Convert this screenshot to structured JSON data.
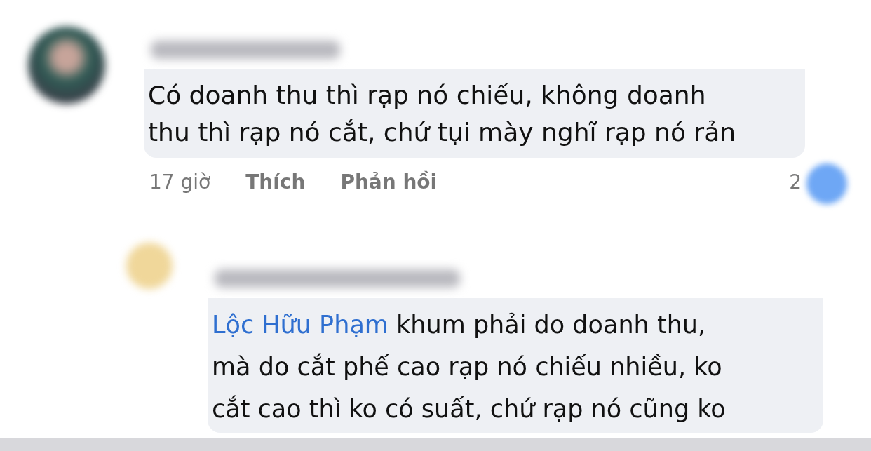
{
  "comments": [
    {
      "text": "Có doanh thu thì rạp nó chiếu, không doanh\nthu thì rạp nó cắt, chứ tụi mày nghĩ rạp nó rản",
      "time": "17 giờ",
      "actions": [
        "Thích",
        "Phản hồi"
      ],
      "reaction_count": "2",
      "replies": [
        {
          "mention": "Lộc Hữu Phạm",
          "text": "khum phải do doanh thu,\nmà do cắt phế cao rạp nó chiếu nhiều, ko\ncắt cao thì ko có suất, chứ rạp nó cũng ko"
        }
      ]
    }
  ]
}
